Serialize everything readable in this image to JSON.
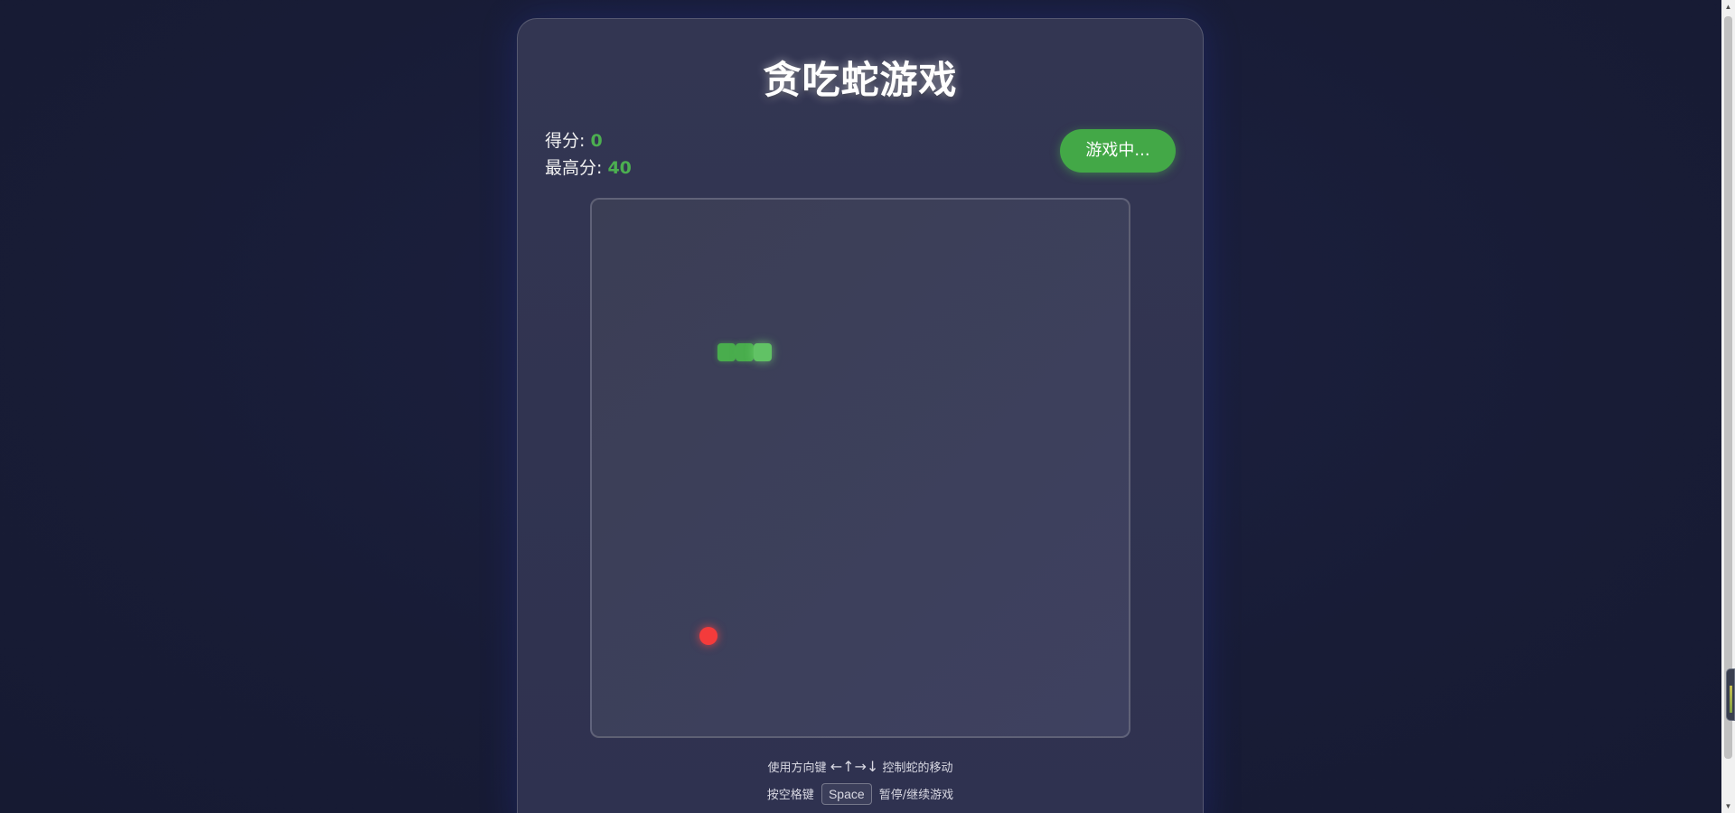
{
  "game": {
    "title": "贪吃蛇游戏",
    "score_label": "得分:",
    "score_value": "0",
    "high_score_label": "最高分:",
    "high_score_value": "40",
    "status_button": "游戏中...",
    "hint_line1_prefix": "使用方向键",
    "hint_line1_arrows": "←↑→↓",
    "hint_line1_suffix": "控制蛇的移动",
    "hint_line2_prefix": "按空格键",
    "hint_line2_key": "Space",
    "hint_line2_suffix": "暂停/继续游戏"
  },
  "board": {
    "grid_size": 30,
    "snake": [
      {
        "col": 7,
        "row": 8,
        "head": false
      },
      {
        "col": 8,
        "row": 8,
        "head": false
      },
      {
        "col": 9,
        "row": 8,
        "head": true
      }
    ],
    "food": {
      "col": 6,
      "row": 24
    }
  },
  "colors": {
    "accent": "#4caf50",
    "snake": "#49ad4d",
    "snake_head": "#61c265",
    "food": "#f43b3b"
  }
}
